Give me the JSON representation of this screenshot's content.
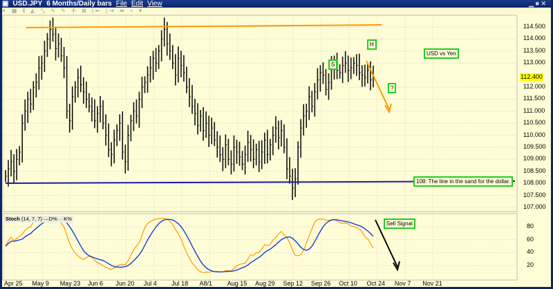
{
  "window": {
    "symbol": "USD.JPY",
    "period": "6 Months/Daily bars",
    "menu": [
      "File",
      "Edit",
      "View"
    ],
    "window_buttons": "▁ ■ ✕"
  },
  "toolbar": {
    "icons": "✕ ▦ ⫴ ◭ ⤡ ✎ ✎ ✛ ⊠ |⇤ |⇥ ⇹ ⌁ ▾"
  },
  "colors": {
    "background": "#fffdd6",
    "bars": "#111111",
    "resistance": "#ff9900",
    "support": "#1a1aaa",
    "k_line": "#ff9900",
    "d_line": "#1a3adb",
    "label_border": "#22cc22",
    "last_price_bg": "#ffff00"
  },
  "price_axis": {
    "ticks": [
      "114.500",
      "114.000",
      "113.500",
      "113.000",
      "112.000",
      "111.500",
      "111.000",
      "110.500",
      "110.000",
      "109.500",
      "109.000",
      "108.500",
      "108.000",
      "107.500",
      "107.000"
    ],
    "last_price": "112.400"
  },
  "stoch_axis": {
    "ticks": [
      "80",
      "60",
      "40",
      "20"
    ]
  },
  "x_axis": {
    "ticks": [
      "Apr 25",
      "May 9",
      "May 23",
      "Jun 6",
      "Jun 20",
      "Jul 4",
      "Jul 18",
      "A8/1",
      "Aug 15",
      "Aug 29",
      "Sep 12",
      "Sep 26",
      "Oct 10",
      "Oct 24",
      "Nov 7",
      "Nov 21"
    ]
  },
  "annotations": {
    "s": "S",
    "h": "H",
    "q": "?",
    "title": "USD vs Yen",
    "support": "108:  The line in the sand for the dollar.",
    "sell": "Sell Signal"
  },
  "stoch": {
    "label": "Stoch",
    "params": "(14, 7, 7)",
    "d_label": "D%",
    "k_label": "K%"
  },
  "chart_data": {
    "type": "ohlc-bar",
    "title": "USD vs Yen",
    "ylim": [
      107,
      114.5
    ],
    "resistance": 114.5,
    "support": 108,
    "closes": [
      108.3,
      108.6,
      108.9,
      108.5,
      109.0,
      109.3,
      110.5,
      111.0,
      111.5,
      111.3,
      112.0,
      112.2,
      112.8,
      113.0,
      113.5,
      114.0,
      114.4,
      114.2,
      113.6,
      113.8,
      113.3,
      112.8,
      111.0,
      110.6,
      111.6,
      112.0,
      112.4,
      112.1,
      111.8,
      111.5,
      111.2,
      111.0,
      110.6,
      110.9,
      111.2,
      110.5,
      110.0,
      109.4,
      109.2,
      109.8,
      110.2,
      110.5,
      109.3,
      108.9,
      110.0,
      110.6,
      111.0,
      110.8,
      111.5,
      112.0,
      112.2,
      112.5,
      112.8,
      113.2,
      113.0,
      113.5,
      114.0,
      114.4,
      113.8,
      113.5,
      113.0,
      112.5,
      113.2,
      112.9,
      112.6,
      112.0,
      111.6,
      111.2,
      110.9,
      110.4,
      110.8,
      110.2,
      110.5,
      110.0,
      110.3,
      109.8,
      109.5,
      109.2,
      109.0,
      109.6,
      109.0,
      108.8,
      109.5,
      109.3,
      109.1,
      108.8,
      109.2,
      109.7,
      109.4,
      109.0,
      109.4,
      108.9,
      109.3,
      109.8,
      109.2,
      109.6,
      110.0,
      110.3,
      109.9,
      110.2,
      109.5,
      108.6,
      108.3,
      107.8,
      108.2,
      109.5,
      110.3,
      110.8,
      111.0,
      111.6,
      111.2,
      111.8,
      112.3,
      112.6,
      112.5,
      111.9,
      112.2,
      112.8,
      113.0,
      112.7,
      112.6,
      112.9,
      113.0,
      112.7,
      112.8,
      113.0,
      112.9,
      112.6,
      112.5,
      112.4,
      112.7,
      112.3,
      112.4
    ]
  }
}
